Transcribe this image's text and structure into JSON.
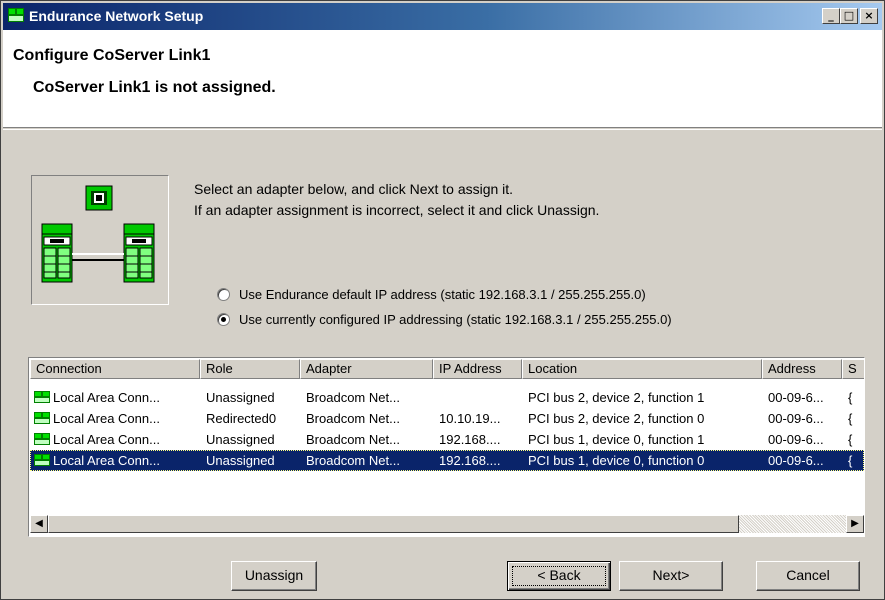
{
  "window": {
    "title": "Endurance Network Setup",
    "title_buttons": {
      "minimize": "_",
      "maximize": "□",
      "close": "×"
    }
  },
  "header": {
    "title": "Configure CoServer Link1",
    "subtitle": "CoServer Link1 is not assigned."
  },
  "instructions": {
    "line1": "Select an adapter below, and click Next to assign it.",
    "line2": "If an adapter assignment is incorrect, select it and click Unassign."
  },
  "ip_options": [
    {
      "label": "Use Endurance default IP address (static 192.168.3.1 / 255.255.255.0)",
      "checked": false
    },
    {
      "label": "Use currently configured IP addressing (static 192.168.3.1 / 255.255.255.0)",
      "checked": true
    }
  ],
  "adapter_list": {
    "columns": [
      "Connection",
      "Role",
      "Adapter",
      "IP Address",
      "Location",
      "Address",
      "S"
    ],
    "rows": [
      {
        "connection": "Local Area Conn...",
        "role": "Unassigned",
        "adapter": "Broadcom Net...",
        "ip": "",
        "location": "PCI bus 2, device 2, function 1",
        "address": "00-09-6...",
        "s": "{"
      },
      {
        "connection": "Local Area Conn...",
        "role": "Redirected0",
        "adapter": "Broadcom Net...",
        "ip": "10.10.19...",
        "location": "PCI bus 2, device 2, function 0",
        "address": "00-09-6...",
        "s": "{"
      },
      {
        "connection": "Local Area Conn...",
        "role": "Unassigned",
        "adapter": "Broadcom Net...",
        "ip": "192.168....",
        "location": "PCI bus 1, device 0, function 1",
        "address": "00-09-6...",
        "s": "{"
      },
      {
        "connection": "Local Area Conn...",
        "role": "Unassigned",
        "adapter": "Broadcom Net...",
        "ip": "192.168....",
        "location": "PCI bus 1, device 0, function 0",
        "address": "00-09-6...",
        "s": "{"
      }
    ],
    "selected_row": 3,
    "scroll_left_glyph": "◀",
    "scroll_right_glyph": "▶"
  },
  "buttons": {
    "unassign": "Unassign",
    "back": "< Back",
    "next": "Next>",
    "cancel": "Cancel"
  },
  "icons": {
    "app": "network-setup-icon",
    "graphic": "network-servers-icon",
    "row": "network-adapter-icon"
  },
  "colors": {
    "title_bar": "#0a246a",
    "selection": "#0a246a",
    "face": "#d4d0c8",
    "server_green": "#00c800"
  }
}
